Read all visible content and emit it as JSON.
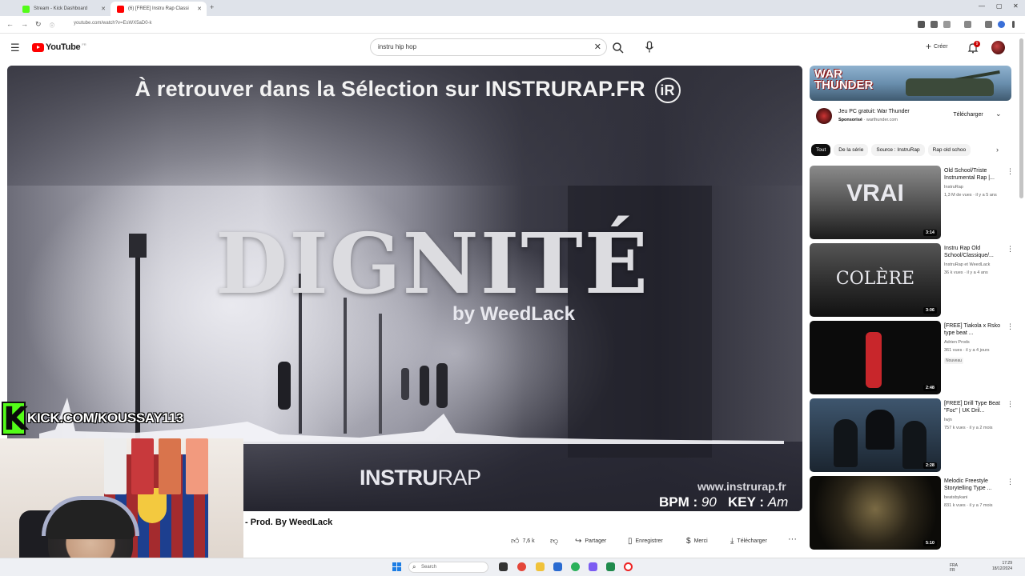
{
  "browser": {
    "tabs": [
      {
        "label": "Stream - Kick Dashboard",
        "favicon_color": "#53fc18"
      },
      {
        "label": "(6) [FREE] Instru Rap Classi",
        "favicon_color": "#ff0000"
      }
    ],
    "url": "youtube.com/watch?v=EsWX5aD0-k"
  },
  "header": {
    "logo": "YouTube",
    "logo_superscript": "FR",
    "search_value": "instru hip hop",
    "create_label": "Créer",
    "notification_count": "9"
  },
  "video": {
    "top_banner": "À retrouver dans la Sélection sur INSTRURAP.FR",
    "banner_badge": "iR",
    "big_title": "DIGNITÉ",
    "by_line": "by WeedLack",
    "logo_bold": "INSTRU",
    "logo_light": "RAP",
    "website": "www.instrurap.fr",
    "bpm_label": "BPM :",
    "bpm_value": "90",
    "key_label": "KEY :",
    "key_value": "Am"
  },
  "overlay": {
    "kick_letter": "K",
    "kick_url": "KICK.COM/KOUSSAY113"
  },
  "below_video": {
    "title_fragment": "- Prod. By WeedLack",
    "likes": "7,6 k",
    "share": "Partager",
    "save": "Enregistrer",
    "thanks": "Merci",
    "download": "Télécharger"
  },
  "sidebar": {
    "ad": {
      "banner_text": "WAR THUNDER",
      "title": "Jeu PC gratuit: War Thunder",
      "sponsored": "Sponsorisé",
      "domain": "warthunder.com",
      "button": "Télécharger"
    },
    "chips": [
      "Tout",
      "De la série",
      "Source : InstruRap",
      "Rap old schoo"
    ],
    "recommendations": [
      {
        "title": "Old School/Triste Instrumental Rap |...",
        "channel": "InstruRap",
        "meta": "1,3 M de vues · il y a 5 ans",
        "duration": "3:14",
        "thumb_text": "VRAI"
      },
      {
        "title": "Instru Rap Old School/Classique/...",
        "channel": "InstruRap et WeedLack",
        "meta": "36 k vues · il y a 4 ans",
        "duration": "3:06",
        "thumb_text": "COLÈRE"
      },
      {
        "title": "[FREE] Tiakola x Rsko type beat ...",
        "channel": "Adrien Prods",
        "meta": "361 vues · il y a 4 jours",
        "duration": "2:48",
        "badge": "Nouveau"
      },
      {
        "title": "[FREE] Drill Type Beat \"Foc\" | UK Dril...",
        "channel": "Iwjn",
        "meta": "757 k vues · il y a 2 mois",
        "duration": "2:28"
      },
      {
        "title": "Melodic Freestyle Storytelling Type ...",
        "channel": "beatsbykani",
        "meta": "831 k vues · il y a 7 mois",
        "duration": "5:10"
      }
    ]
  },
  "taskbar": {
    "search_placeholder": "Search",
    "tray_lang": "FRA",
    "tray_sub": "FR",
    "time": "17:29",
    "date": "18/12/2024"
  },
  "colors": {
    "youtube_red": "#ff0000",
    "kick_green": "#53fc18",
    "accent_dark": "#0f0f0f"
  }
}
